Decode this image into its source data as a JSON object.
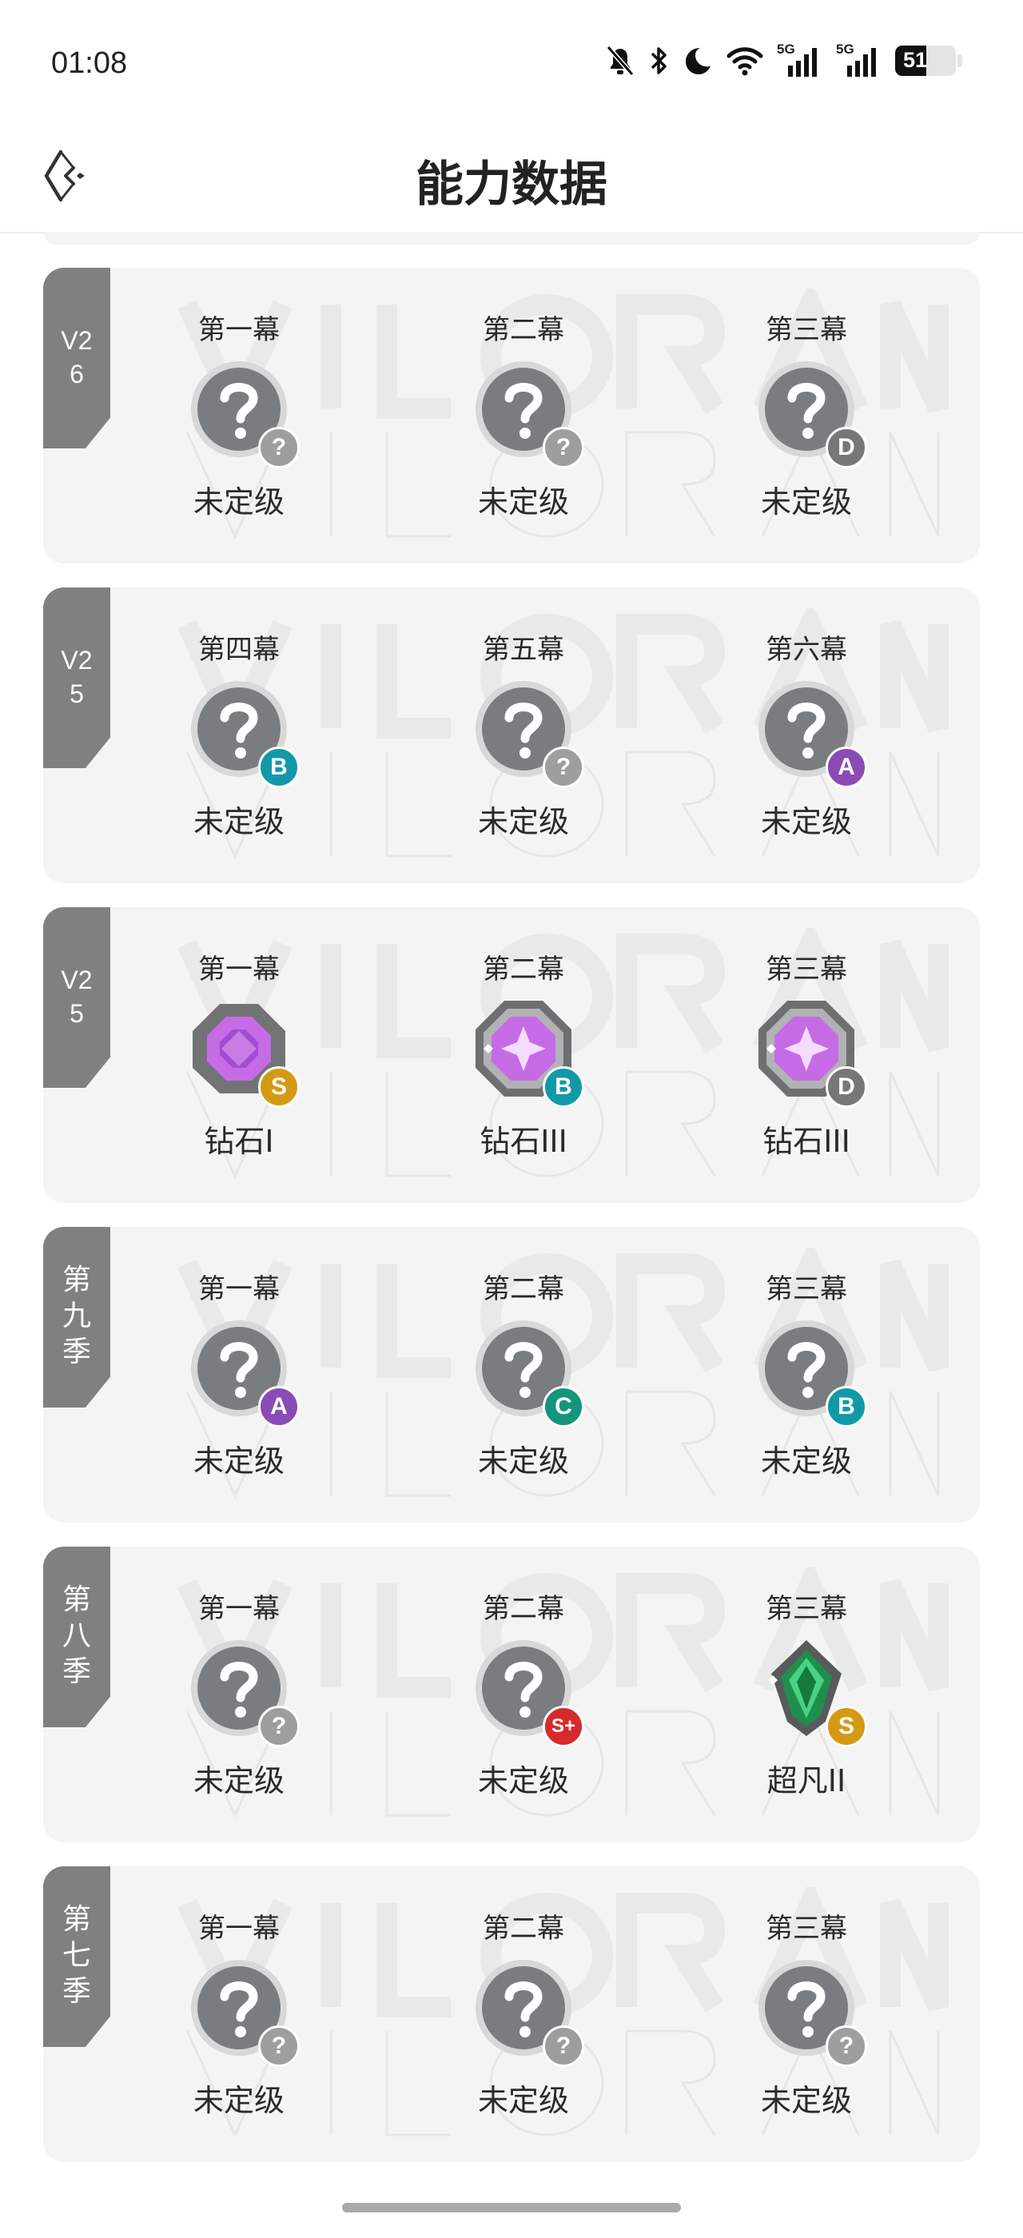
{
  "status_bar": {
    "time": "01:08",
    "network": "5G",
    "battery": "51"
  },
  "header": {
    "title": "能力数据"
  },
  "badge_colors": {
    "?": "#9e9e9e",
    "D": "#777777",
    "B": "#1299a8",
    "A": "#8a4bb5",
    "S": "#d49a14",
    "C": "#14957c",
    "S+": "#d62b2b"
  },
  "seasons": [
    {
      "tag": "V26",
      "tag_lines": [
        "V2",
        "6"
      ],
      "acts": [
        {
          "act": "第一幕",
          "rank": "未定级",
          "rank_icon": "unrated-icon",
          "grade": "?"
        },
        {
          "act": "第二幕",
          "rank": "未定级",
          "rank_icon": "unrated-icon",
          "grade": "?"
        },
        {
          "act": "第三幕",
          "rank": "未定级",
          "rank_icon": "unrated-icon",
          "grade": "D"
        }
      ]
    },
    {
      "tag": "V25",
      "tag_lines": [
        "V2",
        "5"
      ],
      "acts": [
        {
          "act": "第四幕",
          "rank": "未定级",
          "rank_icon": "unrated-icon",
          "grade": "B"
        },
        {
          "act": "第五幕",
          "rank": "未定级",
          "rank_icon": "unrated-icon",
          "grade": "?"
        },
        {
          "act": "第六幕",
          "rank": "未定级",
          "rank_icon": "unrated-icon",
          "grade": "A"
        }
      ]
    },
    {
      "tag": "V25",
      "tag_lines": [
        "V2",
        "5"
      ],
      "acts": [
        {
          "act": "第一幕",
          "rank": "钻石I",
          "rank_icon": "diamond-1-icon",
          "grade": "S"
        },
        {
          "act": "第二幕",
          "rank": "钻石III",
          "rank_icon": "diamond-3-icon",
          "grade": "B"
        },
        {
          "act": "第三幕",
          "rank": "钻石III",
          "rank_icon": "diamond-3-icon",
          "grade": "D"
        }
      ]
    },
    {
      "tag": "第九季",
      "tag_lines": [
        "第",
        "九",
        "季"
      ],
      "acts": [
        {
          "act": "第一幕",
          "rank": "未定级",
          "rank_icon": "unrated-icon",
          "grade": "A"
        },
        {
          "act": "第二幕",
          "rank": "未定级",
          "rank_icon": "unrated-icon",
          "grade": "C"
        },
        {
          "act": "第三幕",
          "rank": "未定级",
          "rank_icon": "unrated-icon",
          "grade": "B"
        }
      ]
    },
    {
      "tag": "第八季",
      "tag_lines": [
        "第",
        "八",
        "季"
      ],
      "acts": [
        {
          "act": "第一幕",
          "rank": "未定级",
          "rank_icon": "unrated-icon",
          "grade": "?"
        },
        {
          "act": "第二幕",
          "rank": "未定级",
          "rank_icon": "unrated-icon",
          "grade": "S+"
        },
        {
          "act": "第三幕",
          "rank": "超凡II",
          "rank_icon": "ascendant-2-icon",
          "grade": "S"
        }
      ]
    },
    {
      "tag": "第七季",
      "tag_lines": [
        "第",
        "七",
        "季"
      ],
      "acts": [
        {
          "act": "第一幕",
          "rank": "未定级",
          "rank_icon": "unrated-icon",
          "grade": "?"
        },
        {
          "act": "第二幕",
          "rank": "未定级",
          "rank_icon": "unrated-icon",
          "grade": "?"
        },
        {
          "act": "第三幕",
          "rank": "未定级",
          "rank_icon": "unrated-icon",
          "grade": "?"
        }
      ]
    }
  ]
}
